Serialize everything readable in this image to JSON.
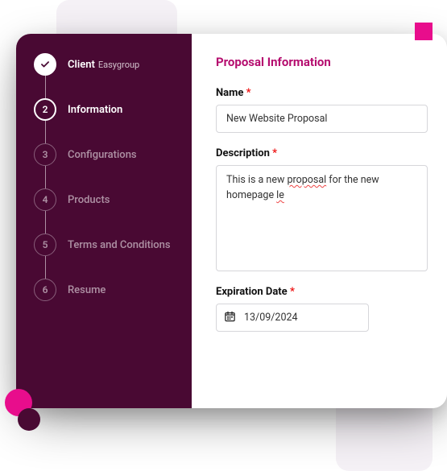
{
  "decor": {},
  "sidebar": {
    "steps": [
      {
        "num": "",
        "label": "Client",
        "sub": "Easygroup",
        "state": "done"
      },
      {
        "num": "2",
        "label": "Information",
        "sub": "",
        "state": "active"
      },
      {
        "num": "3",
        "label": "Configurations",
        "sub": "",
        "state": "dim"
      },
      {
        "num": "4",
        "label": "Products",
        "sub": "",
        "state": "dim"
      },
      {
        "num": "5",
        "label": "Terms and Conditions",
        "sub": "",
        "state": "dim"
      },
      {
        "num": "6",
        "label": "Resume",
        "sub": "",
        "state": "dim"
      }
    ]
  },
  "content": {
    "section_title": "Proposal Information",
    "name": {
      "label": "Name",
      "value": "New Website Proposal"
    },
    "description": {
      "label": "Description",
      "value_plain": "This is a new proposal for the new homepage le",
      "segments": [
        {
          "t": "This is a new ",
          "w": false
        },
        {
          "t": "proposal",
          "w": true
        },
        {
          "t": " for the new homepage ",
          "w": false
        },
        {
          "t": "le",
          "w": true
        }
      ]
    },
    "expiration": {
      "label": "Expiration Date",
      "value": "13/09/2024"
    },
    "required_mark": "*"
  }
}
